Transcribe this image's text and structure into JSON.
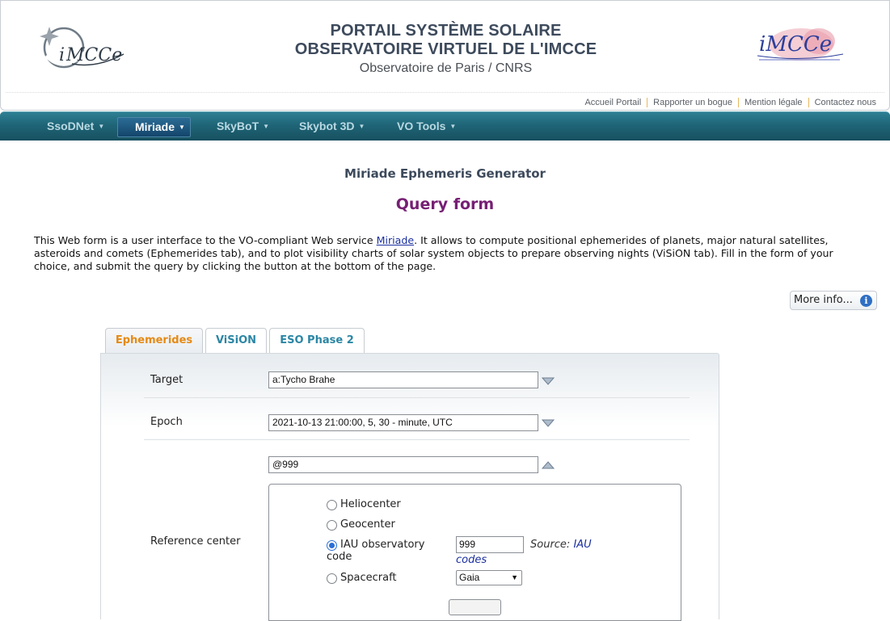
{
  "header": {
    "title_line1": "PORTAIL SYSTÈME SOLAIRE",
    "title_line2": "OBSERVATOIRE VIRTUEL DE L'IMCCE",
    "subtitle": "Observatoire de Paris / CNRS",
    "top_links": [
      "Accueil Portail",
      "Rapporter un bogue",
      "Mention légale",
      "Contactez nous"
    ]
  },
  "nav": {
    "items": [
      {
        "label": "SsoDNet"
      },
      {
        "label": "Miriade"
      },
      {
        "label": "SkyBoT"
      },
      {
        "label": "Skybot 3D"
      },
      {
        "label": "VO Tools"
      }
    ],
    "active": "Miriade"
  },
  "main": {
    "app_title": "Miriade Ephemeris Generator",
    "form_title": "Query form",
    "intro_before_link": "This Web form is a user interface to the VO-compliant Web service ",
    "intro_link": "Miriade",
    "intro_after_link": ". It allows to compute positional ephemerides of planets, major natural satellites, asteroids and comets (Ephemerides tab), and to plot visibility charts of solar system objects to prepare observing nights (ViSiON tab). Fill in the form of your choice, and submit the query by clicking the button at the bottom of the page.",
    "more_info_label": "More info..."
  },
  "tabs": [
    {
      "label": "Ephemerides",
      "active": true
    },
    {
      "label": "ViSiON",
      "active": false
    },
    {
      "label": "ESO Phase 2",
      "active": false
    }
  ],
  "form": {
    "target_label": "Target",
    "target_value": "a:Tycho Brahe",
    "epoch_label": "Epoch",
    "epoch_value": "2021-10-13 21:00:00, 5, 30 - minute, UTC",
    "refcenter_value": "@999",
    "refcenter_label": "Reference center",
    "options": {
      "helio": "Heliocenter",
      "geo": "Geocenter",
      "iau_line1": "IAU observatory",
      "iau_line2": "code",
      "spacecraft": "Spacecraft"
    },
    "selected_option": "iau",
    "iau_code_value": "999",
    "source_label": "Source: ",
    "source_link": "IAU",
    "source_link2": "codes",
    "spacecraft_value": "Gaia"
  },
  "colors": {
    "nav_bg": "#1f6577",
    "active_tab_text": "#e58a14",
    "tab_text": "#2b86a4",
    "form_title": "#761f74",
    "link": "#1a2fa0"
  }
}
